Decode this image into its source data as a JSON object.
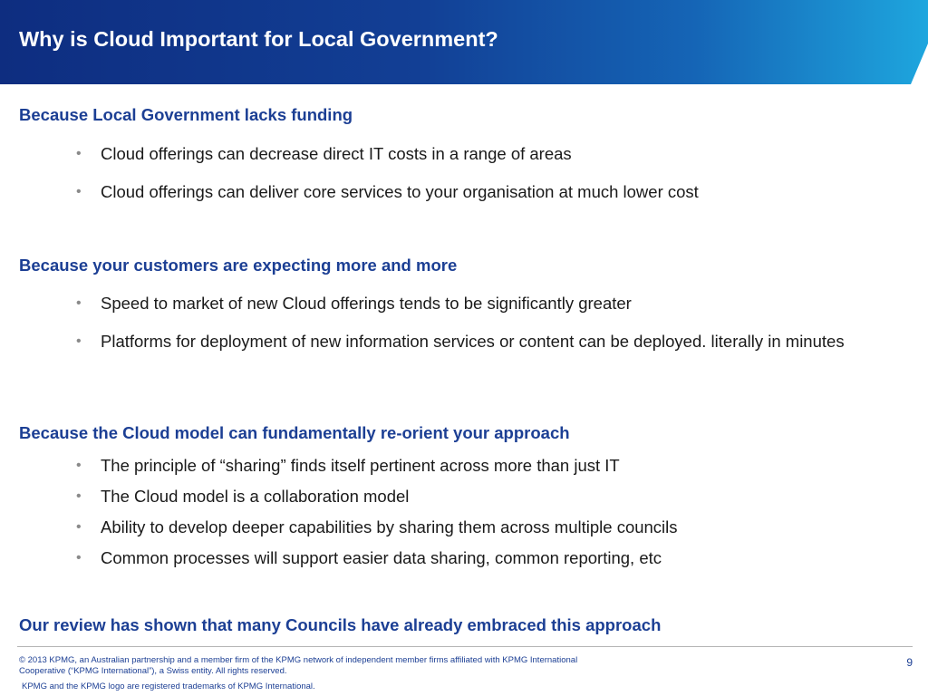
{
  "slide": {
    "title": "Why is Cloud Important for Local Government?"
  },
  "sections": [
    {
      "heading": "Because Local Government lacks funding",
      "bullets": [
        "Cloud offerings can decrease direct IT costs in a range of areas",
        "Cloud offerings can deliver core services to your organisation at much lower cost"
      ]
    },
    {
      "heading": "Because your customers are expecting more and more",
      "bullets": [
        "Speed to market of new Cloud offerings tends to be significantly greater",
        "Platforms for deployment of new information services or content can be deployed. literally in minutes"
      ]
    },
    {
      "heading": "Because the Cloud model can fundamentally re-orient your approach",
      "bullets": [
        "The principle of “sharing” finds itself pertinent across more than just IT",
        "The Cloud model is a collaboration model",
        "Ability to develop deeper capabilities by sharing them across multiple councils",
        "Common processes will support easier data sharing, common reporting, etc"
      ]
    }
  ],
  "conclusion": "Our review has shown that many Councils have already embraced this approach",
  "footer": {
    "copyright_line1": "© 2013 KPMG, an Australian partnership and a member firm of the KPMG network of independent member firms affiliated with KPMG International",
    "copyright_line2": "Cooperative (“KPMG International”), a Swiss entity. All rights reserved.",
    "trademark": "KPMG and the KPMG logo are registered trademarks of KPMG International.",
    "page_number": "9"
  },
  "colors": {
    "heading_blue": "#1c3f94",
    "banner_dark": "#0e2d80",
    "banner_light": "#1ea6de",
    "bullet_gray": "#8a8a8a"
  }
}
